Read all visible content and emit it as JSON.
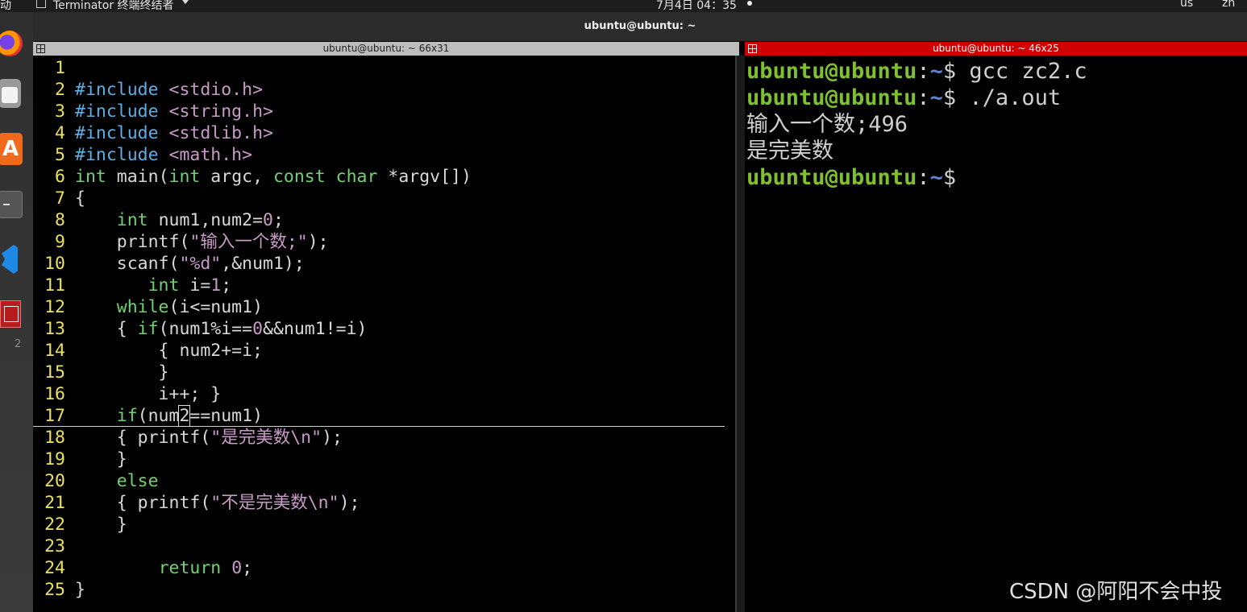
{
  "topbar": {
    "activities": "动",
    "app_menu": "Terminator 终端终结者",
    "clock": "7月4日 04：35",
    "keyboard_layout": "us",
    "language": "zh"
  },
  "dock": {
    "hint": "2"
  },
  "window": {
    "title": "ubuntu@ubuntu: ~"
  },
  "left_pane": {
    "title": "ubuntu@ubuntu: ~ 66x31",
    "lines": [
      {
        "n": "1",
        "html": ""
      },
      {
        "n": "2",
        "html": "<span class='p'>#include</span> <span class='s'>&lt;stdio.h&gt;</span>"
      },
      {
        "n": "3",
        "html": "<span class='p'>#include</span> <span class='s'>&lt;string.h&gt;</span>"
      },
      {
        "n": "4",
        "html": "<span class='p'>#include</span> <span class='s'>&lt;stdlib.h&gt;</span>"
      },
      {
        "n": "5",
        "html": "<span class='p'>#include</span> <span class='s'>&lt;math.h&gt;</span>"
      },
      {
        "n": "6",
        "html": "<span class='k'>int</span> main(<span class='k'>int</span> argc, <span class='k'>const</span> <span class='k'>char</span> *argv[])"
      },
      {
        "n": "7",
        "html": "{"
      },
      {
        "n": "8",
        "html": "    <span class='k'>int</span> num1,num2=<span class='n'>0</span>;"
      },
      {
        "n": "9",
        "html": "    printf(<span class='s'>\"输入一个数;\"</span>);"
      },
      {
        "n": "10",
        "html": "    scanf(<span class='s'>\"%d\"</span>,&amp;num1);"
      },
      {
        "n": "11",
        "html": "       <span class='k'>int</span> i=<span class='n'>1</span>;"
      },
      {
        "n": "12",
        "html": "    <span class='k'>while</span>(i&lt;=num1)"
      },
      {
        "n": "13",
        "html": "    { <span class='k'>if</span>(num1%i==<span class='n'>0</span>&amp;&amp;num1!=i)"
      },
      {
        "n": "14",
        "html": "        { num2+=i;"
      },
      {
        "n": "15",
        "html": "        }"
      },
      {
        "n": "16",
        "html": "        i++; }"
      },
      {
        "n": "17",
        "html": "    <span class='k'>if</span>(num<span class='cursor'>2</span>==num1)"
      },
      {
        "n": "18",
        "html": "    { printf(<span class='s'>\"是完美数\\n\"</span>);"
      },
      {
        "n": "19",
        "html": "    }"
      },
      {
        "n": "20",
        "html": "    <span class='k'>else</span>"
      },
      {
        "n": "21",
        "html": "    { printf(<span class='s'>\"不是完美数\\n\"</span>);"
      },
      {
        "n": "22",
        "html": "    }"
      },
      {
        "n": "23",
        "html": ""
      },
      {
        "n": "24",
        "html": "        <span class='k'>return</span> <span class='n'>0</span>;"
      },
      {
        "n": "25",
        "html": "}"
      }
    ]
  },
  "right_pane": {
    "title": "ubuntu@ubuntu: ~ 46x25",
    "prompt_user": "ubuntu@ubuntu",
    "prompt_path": "~",
    "cmd1": " gcc zc2.c",
    "cmd2": " ./a.out",
    "output1": "输入一个数;496",
    "output2": "是完美数"
  },
  "watermark": "CSDN @阿阳不会中投"
}
